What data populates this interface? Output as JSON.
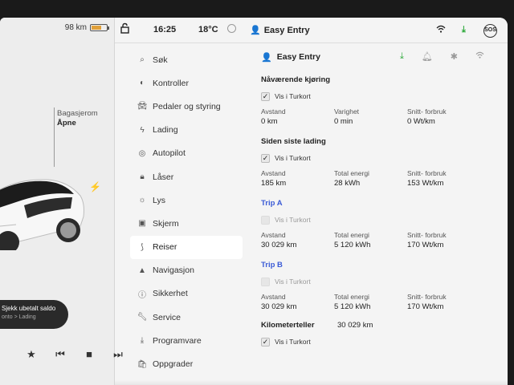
{
  "left_panel": {
    "range": "98 km",
    "trunk_label": "Bagasjerom",
    "trunk_status": "Åpne",
    "alert_title": "Sjekk ubetalt saldo",
    "alert_subtitle": "onto > Lading"
  },
  "status_bar": {
    "time": "16:25",
    "temperature": "18°C",
    "profile": "Easy Entry",
    "sos_label": "SOS"
  },
  "nav": {
    "items": [
      {
        "label": "Søk",
        "icon": "search-icon"
      },
      {
        "label": "Kontroller",
        "icon": "toggle-icon"
      },
      {
        "label": "Pedaler og styring",
        "icon": "car-icon"
      },
      {
        "label": "Lading",
        "icon": "bolt-icon"
      },
      {
        "label": "Autopilot",
        "icon": "steering-wheel-icon"
      },
      {
        "label": "Låser",
        "icon": "lock-icon"
      },
      {
        "label": "Lys",
        "icon": "light-icon"
      },
      {
        "label": "Skjerm",
        "icon": "display-icon"
      },
      {
        "label": "Reiser",
        "icon": "trips-icon",
        "active": true
      },
      {
        "label": "Navigasjon",
        "icon": "navigation-icon"
      },
      {
        "label": "Sikkerhet",
        "icon": "safety-icon"
      },
      {
        "label": "Service",
        "icon": "wrench-icon"
      },
      {
        "label": "Programvare",
        "icon": "download-icon"
      },
      {
        "label": "Oppgrader",
        "icon": "upgrade-icon"
      }
    ]
  },
  "content": {
    "profile": "Easy Entry",
    "current_drive": {
      "title": "Nåværende kjøring",
      "show_in_turkort": "Vis i Turkort",
      "checked": true,
      "distance_label": "Avstand",
      "distance_value": "0 km",
      "duration_label": "Varighet",
      "duration_value": "0 min",
      "avg_label": "Snitt- forbruk",
      "avg_value": "0 Wt/km"
    },
    "since_charge": {
      "title": "Siden siste lading",
      "show_in_turkort": "Vis i Turkort",
      "checked": true,
      "distance_label": "Avstand",
      "distance_value": "185 km",
      "energy_label": "Total energi",
      "energy_value": "28 kWh",
      "avg_label": "Snitt- forbruk",
      "avg_value": "153 Wt/km"
    },
    "trip_a": {
      "title": "Trip A",
      "show_in_turkort": "Vis i Turkort",
      "checked": false,
      "distance_label": "Avstand",
      "distance_value": "30 029 km",
      "energy_label": "Total energi",
      "energy_value": "5 120 kWh",
      "avg_label": "Snitt- forbruk",
      "avg_value": "170 Wt/km"
    },
    "trip_b": {
      "title": "Trip B",
      "show_in_turkort": "Vis i Turkort",
      "checked": false,
      "distance_label": "Avstand",
      "distance_value": "30 029 km",
      "energy_label": "Total energi",
      "energy_value": "5 120 kWh",
      "avg_label": "Snitt- forbruk",
      "avg_value": "170 Wt/km"
    },
    "odometer": {
      "label": "Kilometerteller",
      "value": "30 029 km",
      "show_in_turkort": "Vis i Turkort",
      "checked": true
    }
  },
  "colors": {
    "accent_blue": "#3b5bd6",
    "download_green": "#2aa838",
    "battery_orange": "#e0a03a"
  }
}
